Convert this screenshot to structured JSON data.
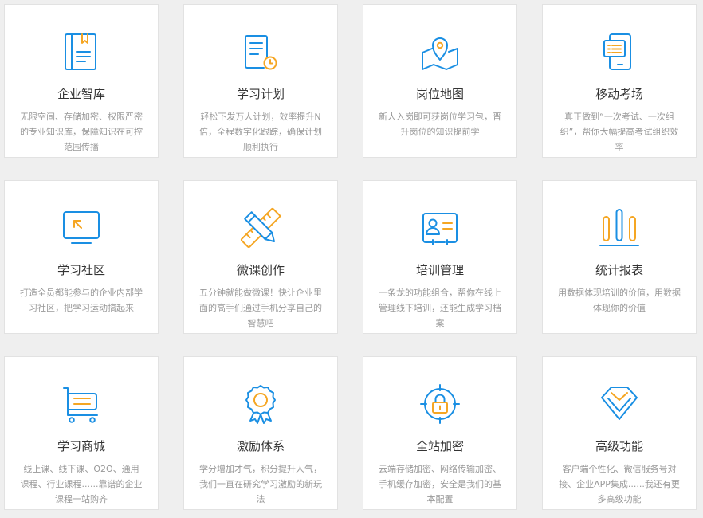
{
  "colors": {
    "blue": "#1a8fe3",
    "orange": "#f5a623"
  },
  "features": [
    {
      "title": "企业智库",
      "desc": "无限空间、存储加密、权限严密的专业知识库，保障知识在可控范围传播",
      "icon": "book-icon"
    },
    {
      "title": "学习计划",
      "desc": "轻松下发万人计划，效率提升N倍，全程数字化跟踪，确保计划顺利执行",
      "icon": "plan-document-clock-icon"
    },
    {
      "title": "岗位地图",
      "desc": "新人入岗即可获岗位学习包，晋升岗位的知识提前学",
      "icon": "map-pin-icon"
    },
    {
      "title": "移动考场",
      "desc": "真正做到“一次考试、一次组织”，帮你大幅提高考试组织效率",
      "icon": "mobile-exam-icon"
    },
    {
      "title": "学习社区",
      "desc": "打造全员都能参与的企业内部学习社区，把学习运动搞起来",
      "icon": "monitor-cursor-icon"
    },
    {
      "title": "微课创作",
      "desc": "五分钟就能做微课！快让企业里面的高手们通过手机分享自己的智慧吧",
      "icon": "pencil-ruler-icon"
    },
    {
      "title": "培训管理",
      "desc": "一条龙的功能组合，帮你在线上管理线下培训，还能生成学习档案",
      "icon": "id-card-icon"
    },
    {
      "title": "统计报表",
      "desc": "用数据体现培训的价值，用数据体现你的价值",
      "icon": "bar-chart-icon"
    },
    {
      "title": "学习商城",
      "desc": "线上课、线下课、O2O、通用课程、行业课程......靠谱的企业课程一站购齐",
      "icon": "shopping-cart-icon"
    },
    {
      "title": "激励体系",
      "desc": "学分增加才气，积分提升人气，我们一直在研究学习激励的新玩法",
      "icon": "award-medal-icon"
    },
    {
      "title": "全站加密",
      "desc": "云端存储加密、网络传输加密、手机缓存加密，安全是我们的基本配置",
      "icon": "lock-target-icon"
    },
    {
      "title": "高级功能",
      "desc": "客户端个性化、微信服务号对接、企业APP集成......我还有更多高级功能",
      "icon": "diamond-icon"
    }
  ]
}
